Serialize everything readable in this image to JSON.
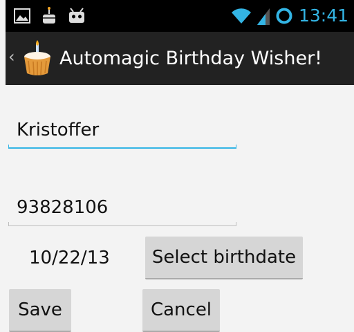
{
  "status_bar": {
    "time": "13:41",
    "icons": [
      "image-notification-icon",
      "cake-notification-icon",
      "android-debug-icon",
      "wifi-icon",
      "signal-icon",
      "sync-ring-icon"
    ],
    "clock_color": "#33b5e5"
  },
  "action_bar": {
    "title": "Automagic Birthday Wisher!",
    "up_caret": "‹",
    "background": "#222222"
  },
  "form": {
    "name_value": "Kristoffer",
    "phone_value": "93828106",
    "birthdate": "10/22/13",
    "select_birthdate_label": "Select birthdate",
    "save_label": "Save",
    "cancel_label": "Cancel",
    "accent_color": "#33b5e5"
  }
}
